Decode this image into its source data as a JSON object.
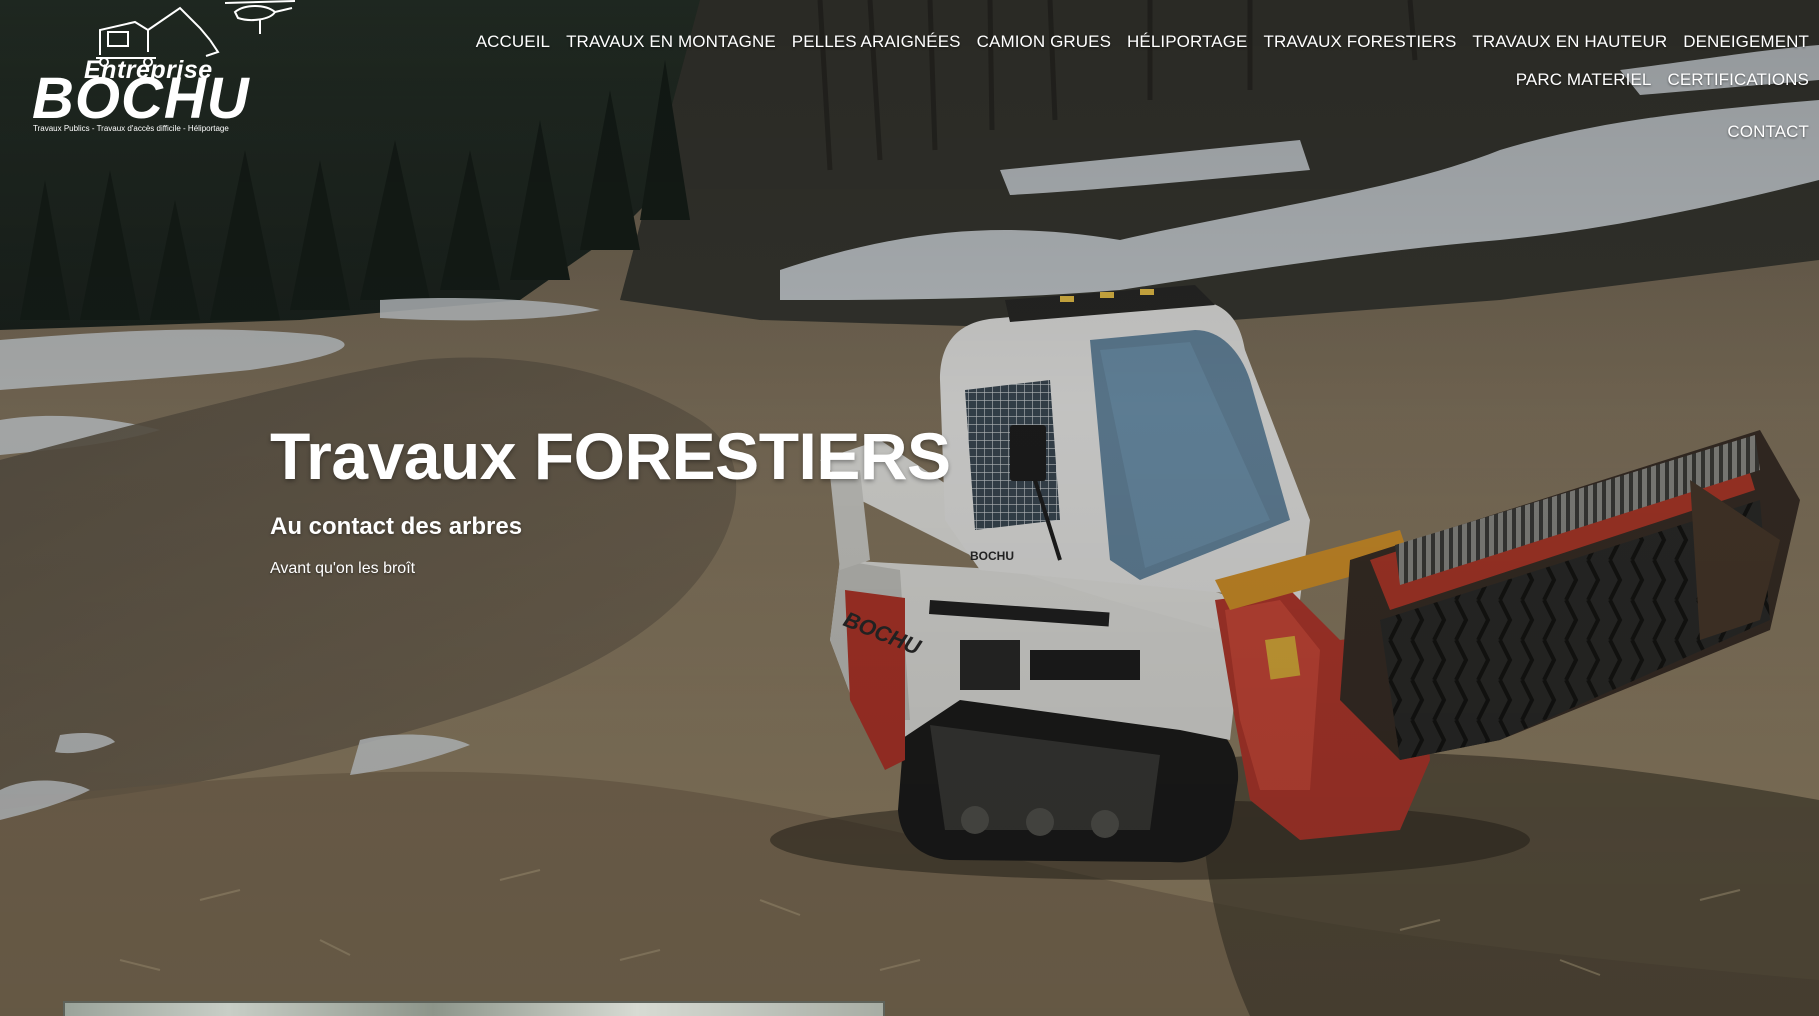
{
  "logo": {
    "word_top": "Entreprise",
    "word_main": "BOCHU",
    "tagline": "Travaux Publics - Travaux d'accès difficile - Héliportage"
  },
  "nav": {
    "items": [
      "ACCUEIL",
      "TRAVAUX EN MONTAGNE",
      "PELLES ARAIGNÉES",
      "CAMION GRUES",
      "HÉLIPORTAGE",
      "TRAVAUX FORESTIERS",
      "TRAVAUX EN HAUTEUR",
      "DENEIGEMENT",
      "PARC MATERIEL",
      "CERTIFICATIONS",
      "CONTACT"
    ]
  },
  "hero": {
    "title": "Travaux FORESTIERS",
    "subtitle": "Au contact des arbres",
    "caption": "Avant qu'on les broît",
    "machine_brand_text": "Entreprise BOCHU"
  },
  "colors": {
    "text": "#ffffff",
    "machine_red": "#c0392b",
    "machine_white": "#e8e8e4",
    "ground": "#8a7a62",
    "forest": "#1f2a22",
    "snow": "#dfe3e6"
  }
}
